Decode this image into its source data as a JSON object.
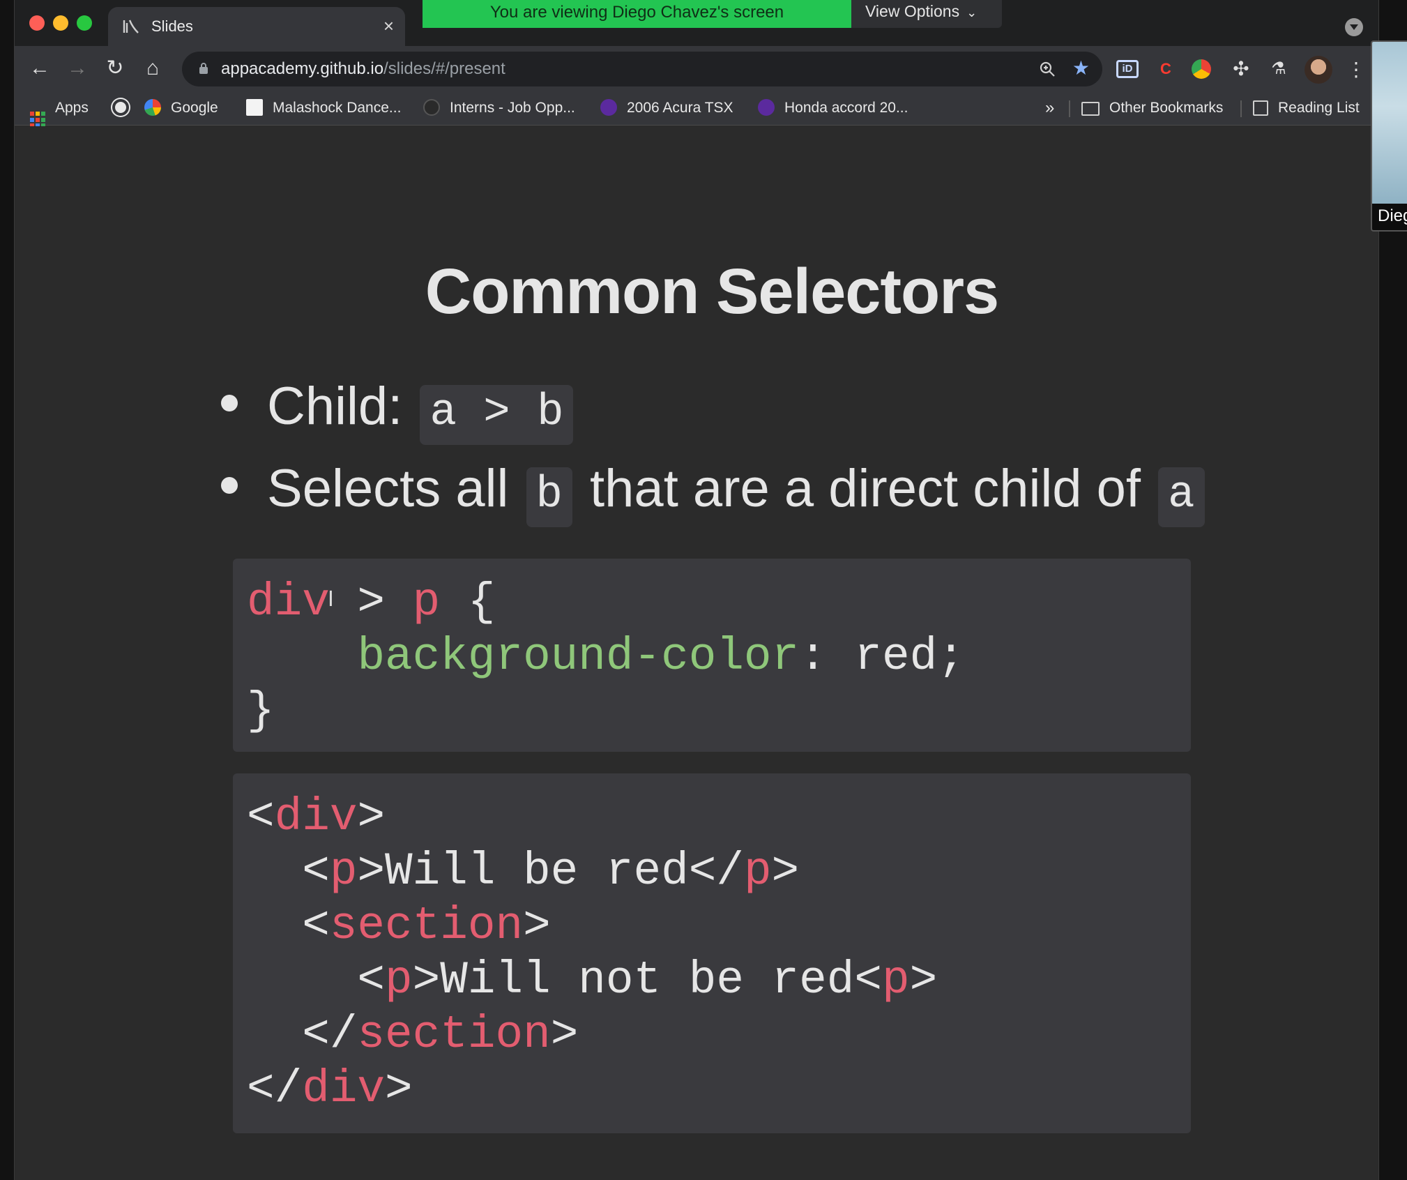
{
  "browser": {
    "tab": {
      "title": "Slides",
      "close_icon": "×"
    },
    "share_banner": {
      "text": "You are viewing Diego Chavez's screen",
      "view_options": "View Options"
    },
    "url": {
      "host": "appacademy.github.io",
      "path": "/slides/#/present"
    },
    "bookmarks": [
      {
        "label": "Apps",
        "icon": "apps-grid-icon"
      },
      {
        "label": "",
        "icon": "globe-icon"
      },
      {
        "label": "Google",
        "icon": "google-icon"
      },
      {
        "label": "Malashock Dance...",
        "icon": "page-icon"
      },
      {
        "label": "Interns - Job Opp...",
        "icon": "circle-icon"
      },
      {
        "label": "2006 Acura TSX",
        "icon": "purple-circle-icon"
      },
      {
        "label": "Honda accord 20...",
        "icon": "purple-circle-icon"
      }
    ],
    "bookmarks_overflow": "»",
    "other_bookmarks": "Other Bookmarks",
    "reading_list": "Reading List"
  },
  "slide": {
    "title": "Common Selectors",
    "bullet1": {
      "text": "Child:",
      "code": "a > b"
    },
    "bullet2": {
      "pre": "Selects all",
      "code_b": "b",
      "mid": "that are a direct child of",
      "code_a": "a"
    }
  },
  "participant": {
    "name": "Dieg"
  },
  "colors": {
    "banner": "#23c552",
    "selector": "#e35d70",
    "property": "#8fc77a",
    "code_bg": "#3a3a3e",
    "slide_bg": "#2b2b2b"
  }
}
